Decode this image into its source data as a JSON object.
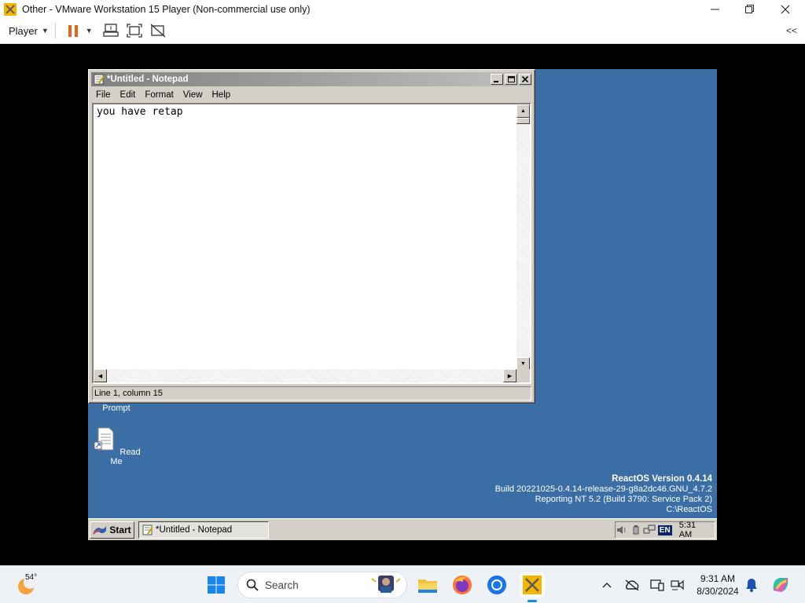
{
  "host": {
    "window_title": "Other - VMware Workstation 15 Player (Non-commercial use only)",
    "player_menu": "Player",
    "collapse_label": "<<"
  },
  "guest": {
    "notepad": {
      "title": "*Untitled - Notepad",
      "menu": [
        "File",
        "Edit",
        "Format",
        "View",
        "Help"
      ],
      "content": "you have retap",
      "status": "Line 1, column 15"
    },
    "desktop_icons": [
      {
        "label": "Prompt"
      },
      {
        "label": "Read Me"
      }
    ],
    "branding": {
      "version": "ReactOS Version 0.4.14",
      "build": "Build 20221025-0.4.14-release-29-g8a2dc46.GNU_4.7.2",
      "reporting": "Reporting NT 5.2 (Build 3790: Service Pack 2)",
      "path": "C:\\ReactOS"
    },
    "taskbar": {
      "start_label": "Start",
      "task_label": "*Untitled - Notepad",
      "lang": "EN",
      "time": "5:31 AM"
    }
  },
  "win_taskbar": {
    "weather_temp": "54°",
    "search_placeholder": "Search",
    "time": "9:31 AM",
    "date": "8/30/2024"
  },
  "colors": {
    "guest_desktop": "#3a6ea5",
    "classic_face": "#d4d0c8",
    "pause_orange": "#e8641b"
  }
}
